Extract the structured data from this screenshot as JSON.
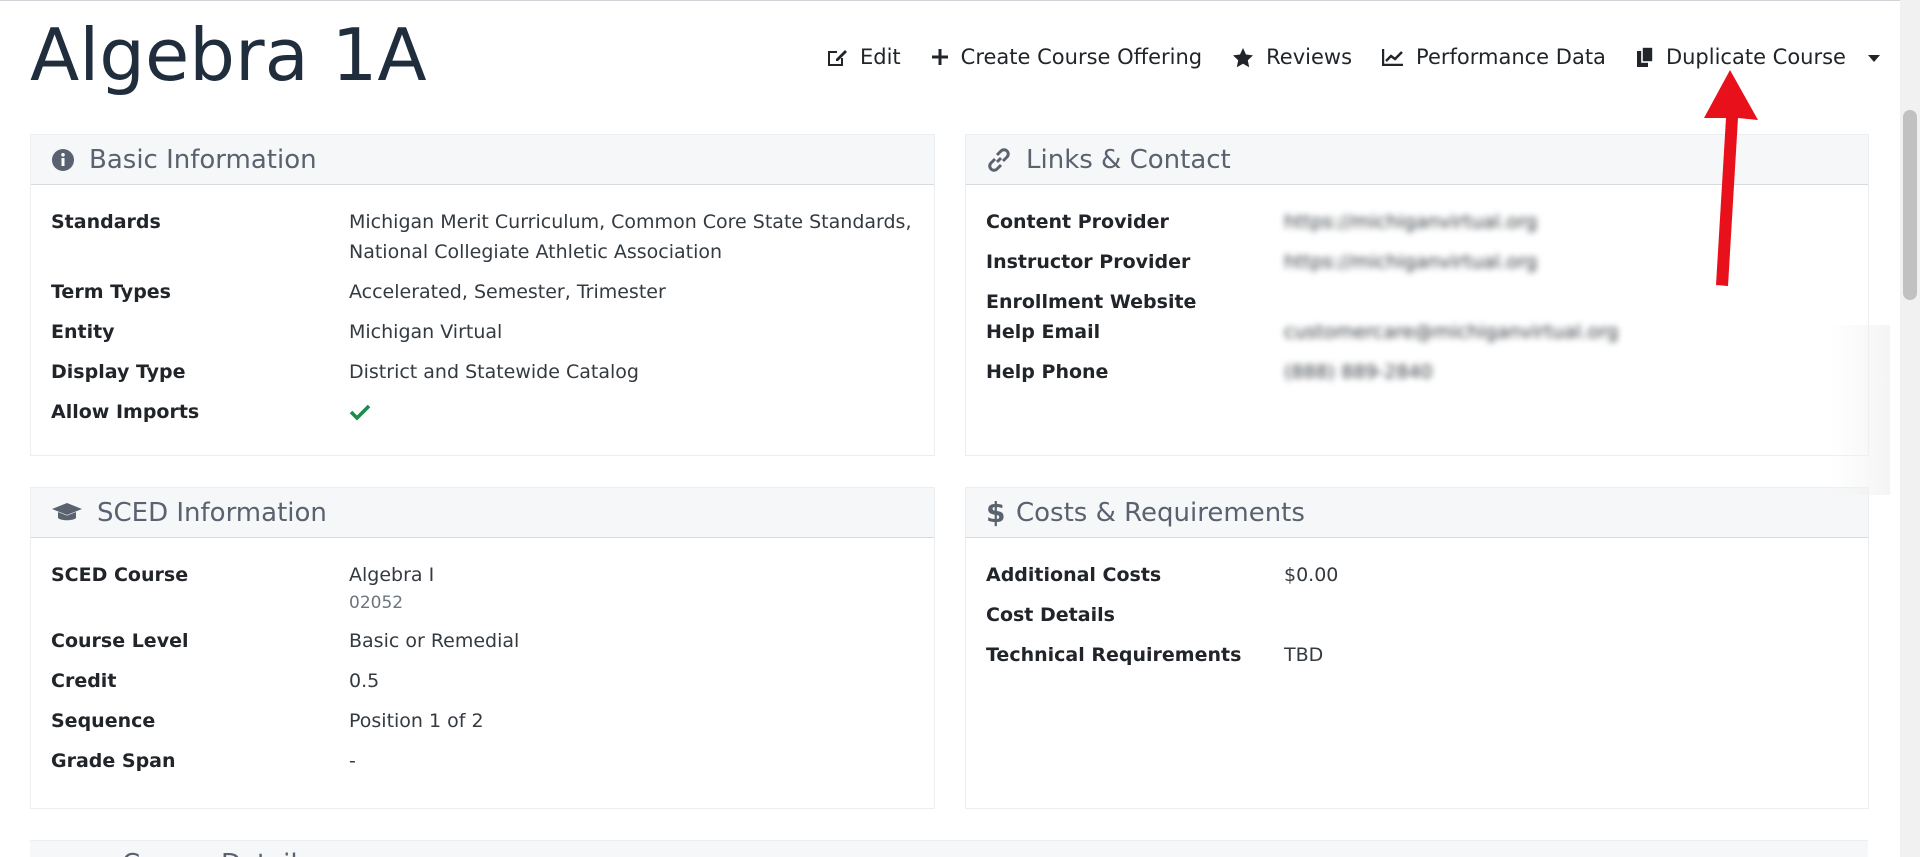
{
  "page": {
    "title": "Algebra 1A"
  },
  "toolbar": {
    "edit": "Edit",
    "create_offering": "Create Course Offering",
    "reviews": "Reviews",
    "performance": "Performance Data",
    "duplicate": "Duplicate Course"
  },
  "basic": {
    "header": "Basic Information",
    "standards_label": "Standards",
    "standards_value_line1": "Michigan Merit Curriculum, Common Core State Standards,",
    "standards_value_line2": "National Collegiate Athletic Association",
    "term_types_label": "Term Types",
    "term_types_value": "Accelerated, Semester, Trimester",
    "entity_label": "Entity",
    "entity_value": "Michigan Virtual",
    "display_type_label": "Display Type",
    "display_type_value": "District and Statewide Catalog",
    "allow_imports_label": "Allow Imports"
  },
  "links": {
    "header": "Links & Contact",
    "content_provider_label": "Content Provider",
    "content_provider_value": "https://michiganvirtual.org",
    "instructor_provider_label": "Instructor Provider",
    "instructor_provider_value": "https://michiganvirtual.org",
    "enrollment_label": "Enrollment Website",
    "help_email_label": "Help Email",
    "help_email_value": "customercare@michiganvirtual.org",
    "help_phone_label": "Help Phone",
    "help_phone_value": "(888) 889-2840"
  },
  "sced": {
    "header": "SCED Information",
    "course_label": "SCED Course",
    "course_value": "Algebra I",
    "course_code": "02052",
    "level_label": "Course Level",
    "level_value": "Basic or Remedial",
    "credit_label": "Credit",
    "credit_value": "0.5",
    "sequence_label": "Sequence",
    "sequence_value": "Position 1 of 2",
    "grade_span_label": "Grade Span",
    "grade_span_value": "-"
  },
  "costs": {
    "header": "Costs & Requirements",
    "additional_label": "Additional Costs",
    "additional_value": "$0.00",
    "details_label": "Cost Details",
    "tech_label": "Technical Requirements",
    "tech_value": "TBD"
  },
  "bottom": {
    "header": "Course Details"
  },
  "colors": {
    "accent_check": "#1e8a4c",
    "arrow": "#e8101a"
  }
}
